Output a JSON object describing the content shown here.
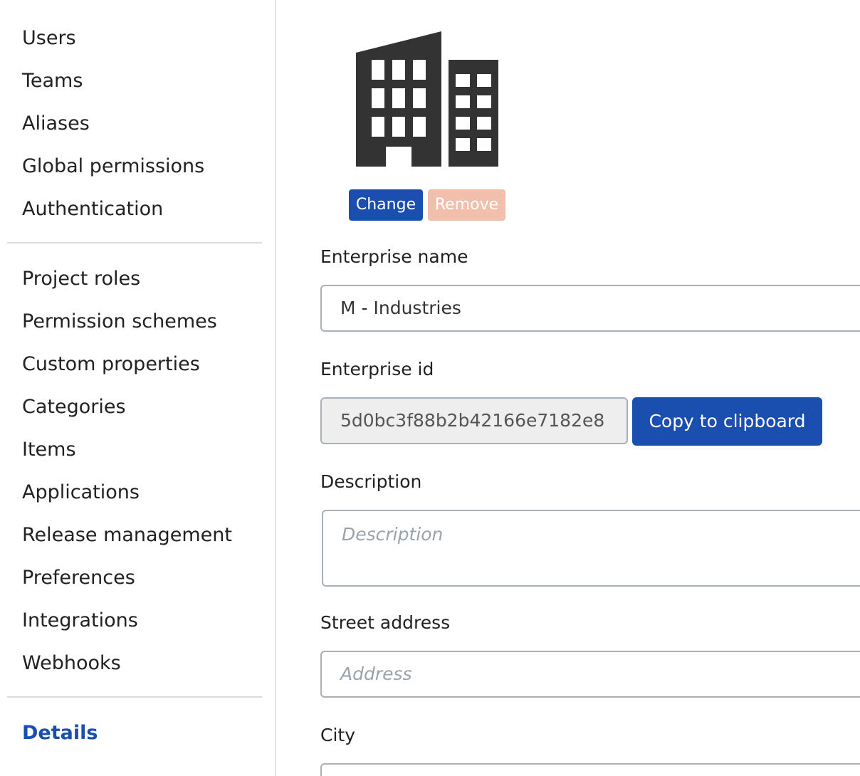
{
  "sidebar": {
    "group1": [
      "Users",
      "Teams",
      "Aliases",
      "Global permissions",
      "Authentication"
    ],
    "group2": [
      "Project roles",
      "Permission schemes",
      "Custom properties",
      "Categories",
      "Items",
      "Applications",
      "Release management",
      "Preferences",
      "Integrations",
      "Webhooks"
    ],
    "group3": [
      "Details"
    ],
    "active": "Details"
  },
  "logo": {
    "icon": "building-icon",
    "change_label": "Change",
    "remove_label": "Remove"
  },
  "form": {
    "name_label": "Enterprise name",
    "name_value": "M - Industries",
    "id_label": "Enterprise id",
    "id_value": "5d0bc3f88b2b42166e7182e8",
    "copy_label": "Copy to clipboard",
    "description_label": "Description",
    "description_placeholder": "Description",
    "street_label": "Street address",
    "street_placeholder": "Address",
    "city_label": "City"
  },
  "colors": {
    "primary": "#1a4fb0",
    "danger_disabled": "#f2bfad",
    "icon": "#333333"
  }
}
